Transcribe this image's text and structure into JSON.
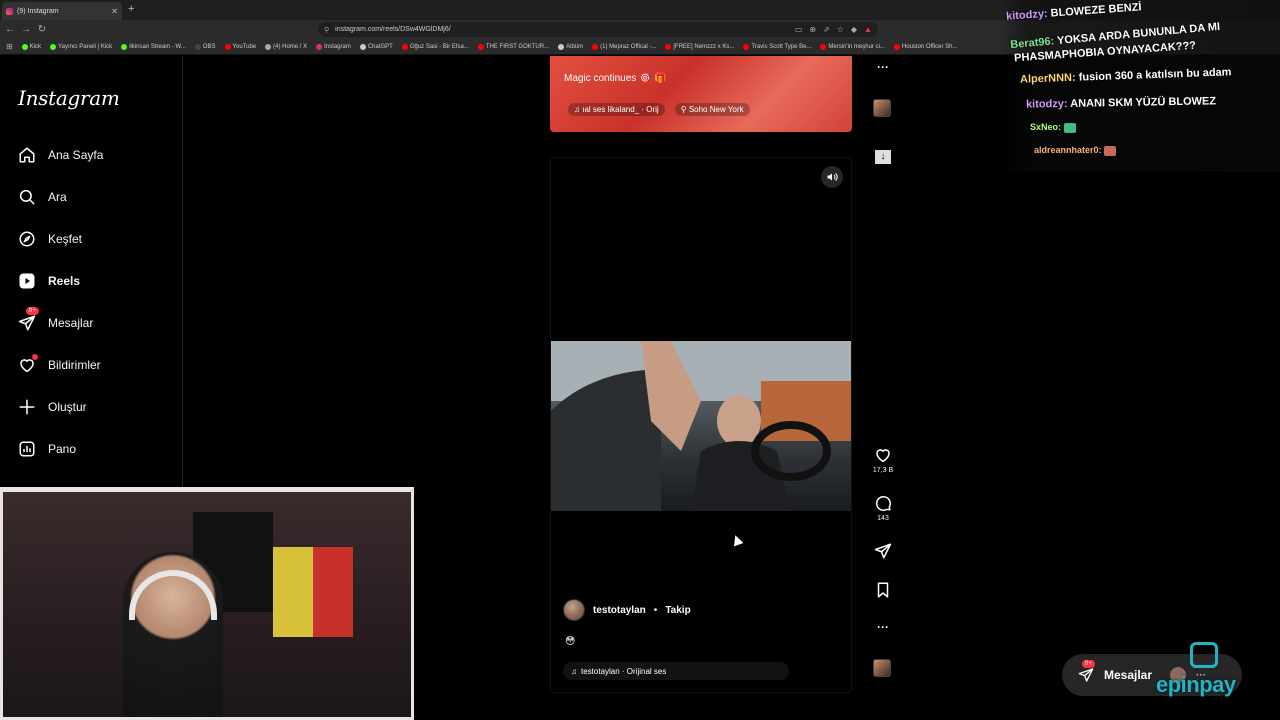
{
  "browser": {
    "tab_title": "(9) Instagram",
    "new_tab_symbol": "+",
    "url": "instagram.com/reels/DSw4WGlDMj6/",
    "bookmarks": [
      {
        "label": "Kick",
        "color": "#53fc18"
      },
      {
        "label": "Yayıncı Paneli | Kick",
        "color": "#53fc18"
      },
      {
        "label": "ilkinsan Stream - W...",
        "color": "#53fc18"
      },
      {
        "label": "OBS",
        "color": "#444444"
      },
      {
        "label": "YouTube",
        "color": "#ff0000"
      },
      {
        "label": "(4) Home / X",
        "color": "#aaaaaa"
      },
      {
        "label": "Instagram",
        "color": "#dd2a7b"
      },
      {
        "label": "ChatGPT",
        "color": "#cccccc"
      },
      {
        "label": "Oğuz Sasi - Bir Efsa...",
        "color": "#ff0000"
      },
      {
        "label": "THE FIRST GOKTUR...",
        "color": "#ff0000"
      },
      {
        "label": "Albüm",
        "color": "#cccccc"
      },
      {
        "label": "(1) Mepraz Offical -...",
        "color": "#ff0000"
      },
      {
        "label": "[FREE] Nemzzz x Ks...",
        "color": "#ff0000"
      },
      {
        "label": "Travis Scott Type Be...",
        "color": "#ff0000"
      },
      {
        "label": "Mersin'in meşhur ci...",
        "color": "#ff0000"
      },
      {
        "label": "Houston Officer Sh...",
        "color": "#ff0000"
      }
    ]
  },
  "sidebar": {
    "logo": "Instagram",
    "items": [
      {
        "label": "Ana Sayfa",
        "icon": "home-icon"
      },
      {
        "label": "Ara",
        "icon": "search-icon"
      },
      {
        "label": "Keşfet",
        "icon": "compass-icon"
      },
      {
        "label": "Reels",
        "icon": "reels-icon"
      },
      {
        "label": "Mesajlar",
        "icon": "messenger-icon",
        "badge": "9+"
      },
      {
        "label": "Bildirimler",
        "icon": "heart-icon"
      },
      {
        "label": "Oluştur",
        "icon": "plus-icon"
      },
      {
        "label": "Pano",
        "icon": "dashboard-icon"
      }
    ]
  },
  "reel_top": {
    "caption": "Magic continues 🎯 🎁",
    "audio": "ıal ses  likaland_ · Orij",
    "location": "Soho New York"
  },
  "reel_main": {
    "author": "testotaylan",
    "separator": "•",
    "follow_label": "Takip",
    "caption_emoji": "😳",
    "audio": "testotaylan · Orijinal ses"
  },
  "actions": {
    "likes": "17,3 B",
    "comments": "143"
  },
  "chat": [
    {
      "user": "kitodzy:",
      "text": "BLOWEZE BENZİ",
      "color": "#d19bff"
    },
    {
      "user": "Berat96:",
      "text": "YOKSA ARDA BUNUNLA DA MI",
      "color": "#7fe39a"
    },
    {
      "user": "",
      "text": "PHASMAPHOBIA OYNAYACAK???",
      "color": "#ffffff"
    },
    {
      "user": "AlperNNN:",
      "text": "fusion 360 a katılsın bu adam",
      "color": "#ffd27a"
    },
    {
      "user": "kitodzy:",
      "text": "ANANI SKM YÜZÜ BLOWEZ",
      "color": "#d19bff"
    },
    {
      "user": "SxNeo:",
      "text": "",
      "color": "#b3ff7a"
    },
    {
      "user": "aldreannhater0:",
      "text": "",
      "color": "#ffb07a"
    }
  ],
  "floating_messages": {
    "label": "Mesajlar",
    "badge": "9+",
    "more": "···"
  },
  "brand": "epinpay"
}
